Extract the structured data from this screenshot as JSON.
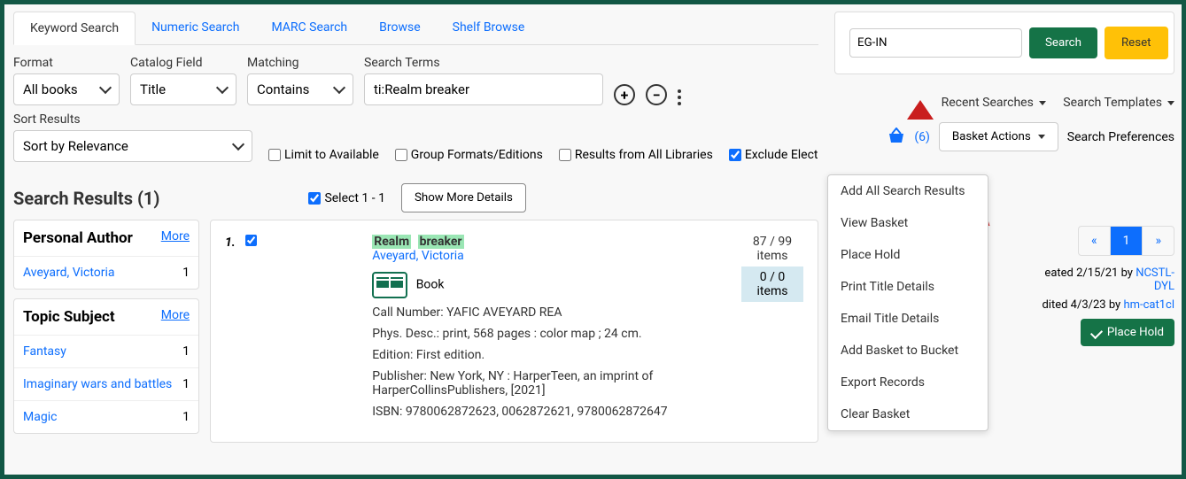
{
  "tabs": {
    "keyword": "Keyword Search",
    "numeric": "Numeric Search",
    "marc": "MARC Search",
    "browse": "Browse",
    "shelf": "Shelf Browse"
  },
  "form": {
    "format_label": "Format",
    "format_value": "All books",
    "field_label": "Catalog Field",
    "field_value": "Title",
    "matching_label": "Matching",
    "matching_value": "Contains",
    "terms_label": "Search Terms",
    "terms_value": "ti:Realm breaker",
    "sort_label": "Sort Results",
    "sort_value": "Sort by Relevance",
    "limit_available": "Limit to Available",
    "group_formats": "Group Formats/Editions",
    "results_all": "Results from All Libraries",
    "exclude_elec": "Exclude Elect"
  },
  "results": {
    "heading": "Search Results (1)",
    "select_label": "Select 1 - 1",
    "show_more": "Show More Details"
  },
  "facets": {
    "pa_head": "Personal Author",
    "more": "More",
    "pa_item1": "Aveyard, Victoria",
    "pa_count1": "1",
    "ts_head": "Topic Subject",
    "ts_item1": "Fantasy",
    "ts_count1": "1",
    "ts_item2": "Imaginary wars and battles",
    "ts_count2": "1",
    "ts_item3": "Magic",
    "ts_count3": "1"
  },
  "record": {
    "index": "1.",
    "title_hl1": "Realm",
    "title_hl2": "breaker",
    "author": "Aveyard, Victoria",
    "format": "Book",
    "call_label": "Call Number: ",
    "call_value": "YAFIC AVEYARD REA",
    "phys_label": "Phys. Desc.: ",
    "phys_value": "print, 568 pages : color map ; 24 cm.",
    "edition_label": "Edition: ",
    "edition_value": "First edition.",
    "pub_label": "Publisher: ",
    "pub_value": "New York, NY : HarperTeen, an imprint of HarperCollinsPublishers, [2021]",
    "isbn_label": "ISBN: ",
    "isbn_value": "9780062872623, 0062872621, 9780062872647",
    "items_avail": "87 / 99",
    "items_label": "items",
    "items_here": "0 / 0",
    "created_prefix": "eated 2/15/21 by ",
    "created_by": "NCSTL-DYL",
    "edited_prefix": "dited 4/3/23 by ",
    "edited_by": "hm-cat1cl",
    "place_hold": "Place Hold"
  },
  "right": {
    "search_value": "EG-IN",
    "search_btn": "Search",
    "reset_btn": "Reset",
    "recent": "Recent Searches",
    "templates": "Search Templates",
    "prefs": "Search Preferences",
    "basket_count": "(6)",
    "basket_actions": "Basket Actions"
  },
  "dropdown": {
    "add_all": "Add All Search Results",
    "view": "View Basket",
    "hold": "Place Hold",
    "print": "Print Title Details",
    "email": "Email Title Details",
    "bucket": "Add Basket to Bucket",
    "export": "Export Records",
    "clear": "Clear Basket"
  },
  "pagination": {
    "prev": "«",
    "page": "1",
    "next": "»"
  }
}
